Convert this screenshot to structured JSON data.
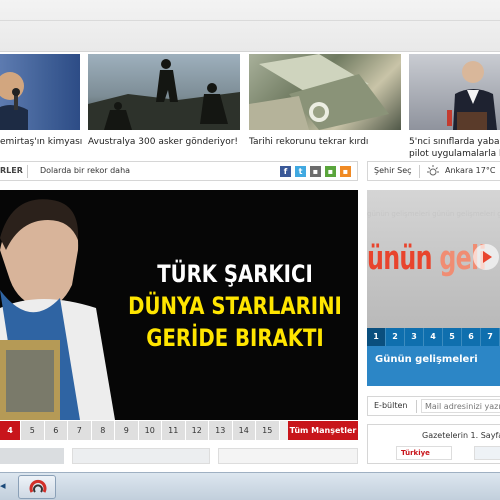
{
  "news_thumbs": [
    {
      "caption": "emirtaş'ın kimyası"
    },
    {
      "caption": "Avustralya 300 asker gönderiyor!"
    },
    {
      "caption": "Tarihi rekorunu tekrar kırdı"
    },
    {
      "caption": "5'nci sınıflarda yabanc",
      "caption2": "pilot uygulamalarla ba"
    }
  ],
  "ticker": {
    "label": "RLER",
    "text": "Dolarda bir rekor daha"
  },
  "social": {
    "fb": "f",
    "tw": "t",
    "t3": "▪",
    "t4": "▪",
    "rss": "▪"
  },
  "city_bar": {
    "select": "Şehir Seç",
    "weather": "Ankara 17°C"
  },
  "hero": {
    "line1": "TÜRK ŞARKICI",
    "line2": "DÜNYA STARLARINI",
    "line3": "GERİDE BIRAKTI"
  },
  "pager": {
    "pages": [
      "4",
      "5",
      "6",
      "7",
      "8",
      "9",
      "10",
      "11",
      "12",
      "13",
      "14",
      "15"
    ],
    "all_label": "Tüm Manşetler"
  },
  "side_promo": {
    "bg_text": "günün gelişmeleri günün gelişmeleri günün gelişmeleri",
    "big_a": "ünün ",
    "big_b": "geli",
    "tabs": [
      "1",
      "2",
      "3",
      "4",
      "5",
      "6",
      "7"
    ],
    "caption": "Günün gelişmeleri"
  },
  "ebulten": {
    "label": "E-bülten",
    "placeholder": "Mail adresinizi yazın"
  },
  "gazete": {
    "title": "Gazetelerin 1. Sayfa",
    "logo": "Türkiye"
  },
  "colors": {
    "accent_red": "#c8151b",
    "accent_blue": "#2c86c6",
    "headline_yellow": "#ffe500"
  }
}
